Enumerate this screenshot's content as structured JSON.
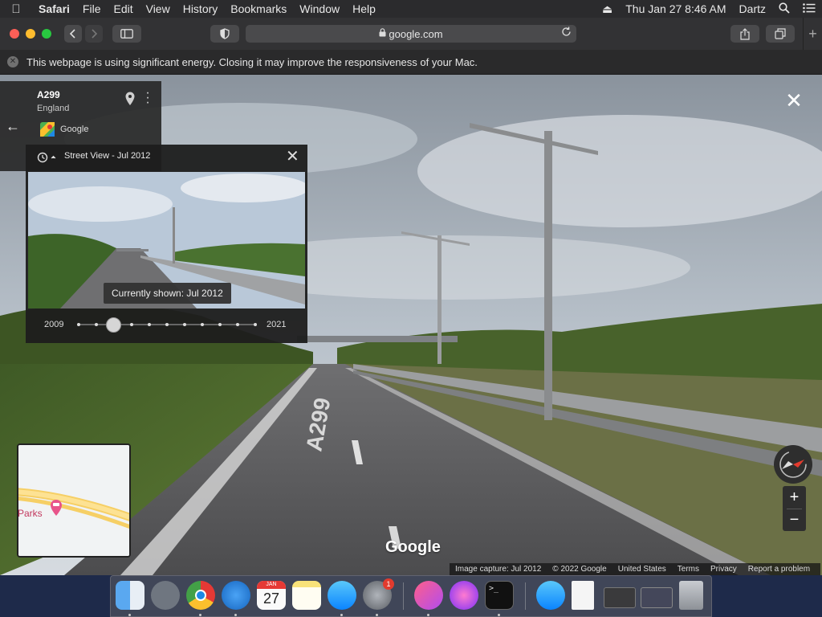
{
  "menubar": {
    "app": "Safari",
    "items": [
      "File",
      "Edit",
      "View",
      "History",
      "Bookmarks",
      "Window",
      "Help"
    ],
    "clock": "Thu Jan 27  8:46 AM",
    "user": "Dartz"
  },
  "toolbar": {
    "url": "google.com"
  },
  "banner": {
    "message": "This webpage is using significant energy. Closing it may improve the responsiveness of your Mac."
  },
  "infocard": {
    "title": "A299",
    "subtitle": "England",
    "provider": "Google"
  },
  "timemachine": {
    "title": "Street View - Jul 2012",
    "tooltip": "Currently shown: Jul 2012",
    "start_year": "2009",
    "end_year": "2021",
    "selected_index": 2,
    "tick_count": 11
  },
  "minimap": {
    "place": "Parks"
  },
  "logo": "Google",
  "attribution": {
    "capture": "Image capture: Jul 2012",
    "copyright": "© 2022 Google",
    "region": "United States",
    "terms": "Terms",
    "privacy": "Privacy",
    "report": "Report a problem"
  },
  "road_marking": "A299",
  "dock": {
    "calendar_month": "JAN",
    "calendar_day": "27",
    "badge_count": "1"
  },
  "colors": {
    "sky": "#8a97a6",
    "road": "#5a5a5c",
    "grass": "#4f6a2e",
    "accent_red": "#e23b2e"
  }
}
